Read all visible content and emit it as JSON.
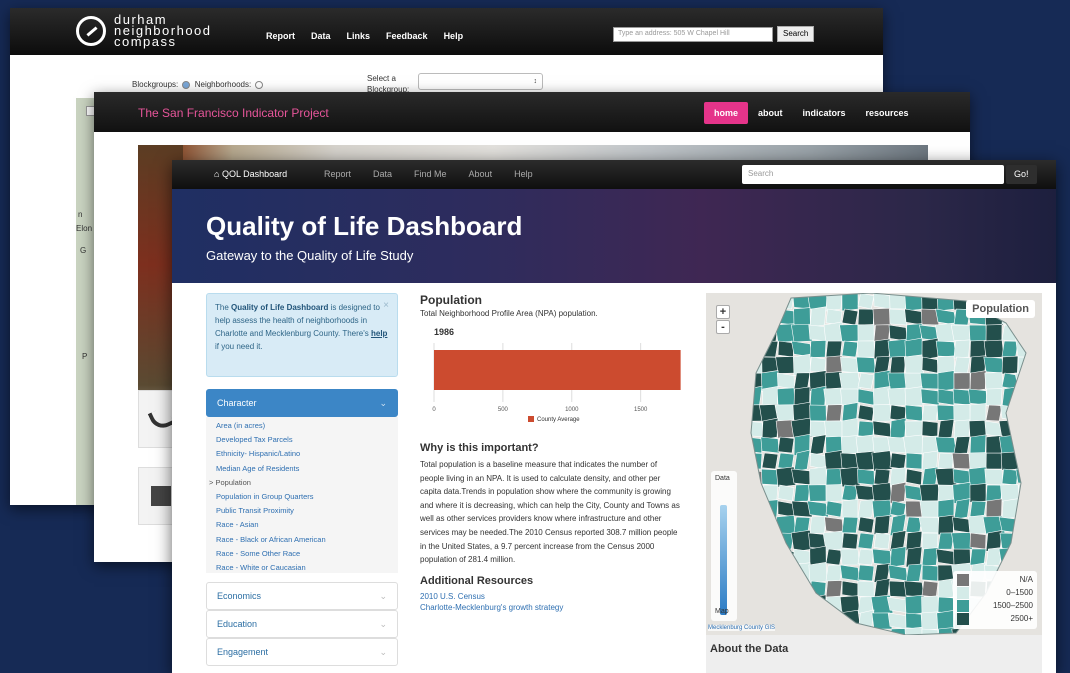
{
  "durham": {
    "logo_lines": [
      "durham",
      "neighborhood",
      "compass"
    ],
    "menu": [
      "Report",
      "Data",
      "Links",
      "Feedback",
      "Help"
    ],
    "search_placeholder": "Type an address: 505 W Chapel Hill",
    "search_button": "Search",
    "blockgroups_label": "Blockgroups:",
    "neighborhoods_label": "Neighborhoods:",
    "select_label": "Select a Blockgroup:",
    "select_value": "↕",
    "map_text": [
      "n",
      "Elon",
      "G",
      "P"
    ]
  },
  "sf": {
    "brand": "The San Francisco Indicator Project",
    "menu": [
      "home",
      "about",
      "indicators",
      "resources"
    ],
    "active_menu": "home"
  },
  "qol": {
    "brand": "QOL Dashboard",
    "menu": [
      "Report",
      "Data",
      "Find Me",
      "About",
      "Help"
    ],
    "search_placeholder": "Search",
    "go_button": "Go!",
    "title": "Quality of Life Dashboard",
    "subtitle": "Gateway to the Quality of Life Study",
    "alert": {
      "pre": "The ",
      "bold": "Quality of Life Dashboard",
      "mid": " is designed to help assess the health of neighborhoods in Charlotte and Mecklenburg County. There's ",
      "link": "help",
      "post": " if you need it.",
      "close": "×"
    },
    "accordion": {
      "active": "Character",
      "items": [
        "Area (in acres)",
        "Developed Tax Parcels",
        "Ethnicity- Hispanic/Latino",
        "Median Age of Residents",
        "Population",
        "Population in Group Quarters",
        "Public Transit Proximity",
        "Race - Asian",
        "Race - Black or African American",
        "Race - Some Other Race",
        "Race - White or Caucasian"
      ],
      "selected": "Population",
      "selected_marker": ">",
      "collapsed": [
        "Economics",
        "Education",
        "Engagement"
      ]
    },
    "main": {
      "heading": "Population",
      "description": "Total Neighborhood Profile Area (NPA) population.",
      "why_heading": "Why is this important?",
      "why_text": "Total population is a baseline measure that indicates the number of people living in an NPA. It is used to calculate density, and other per capita data.Trends in population show where the community is growing and where it is decreasing, which can help the City, County and Towns as well as other services providers know where infrastructure and other services may be needed.The 2010 Census reported 308.7 million people in the United States, a 9.7 percent increase from the Census 2000 population of 281.4 million.",
      "resources_heading": "Additional Resources",
      "resources": [
        "2010 U.S. Census",
        "Charlotte-Mecklenburg's growth strategy"
      ]
    },
    "map": {
      "title": "Population",
      "zoom_in": "+",
      "zoom_out": "-",
      "slider_top": "Data",
      "slider_bottom": "Map",
      "attribution": "Mecklenburg County GIS",
      "legend": [
        {
          "label": "N/A",
          "color": "#777777"
        },
        {
          "label": "0–1500",
          "color": "#d4ebe8"
        },
        {
          "label": "1500–2500",
          "color": "#3e9d98"
        },
        {
          "label": "2500+",
          "color": "#234f4c"
        }
      ]
    },
    "about_heading": "About the Data"
  },
  "chart_data": {
    "type": "bar",
    "title": "1986",
    "categories": [
      "County Average"
    ],
    "series": [
      {
        "name": "County Average",
        "values": [
          1790
        ]
      }
    ],
    "xlim": [
      0,
      1800
    ],
    "xticks": [
      0,
      500,
      1000,
      1500
    ],
    "orientation": "horizontal",
    "bar_color": "#cc4b2f"
  }
}
